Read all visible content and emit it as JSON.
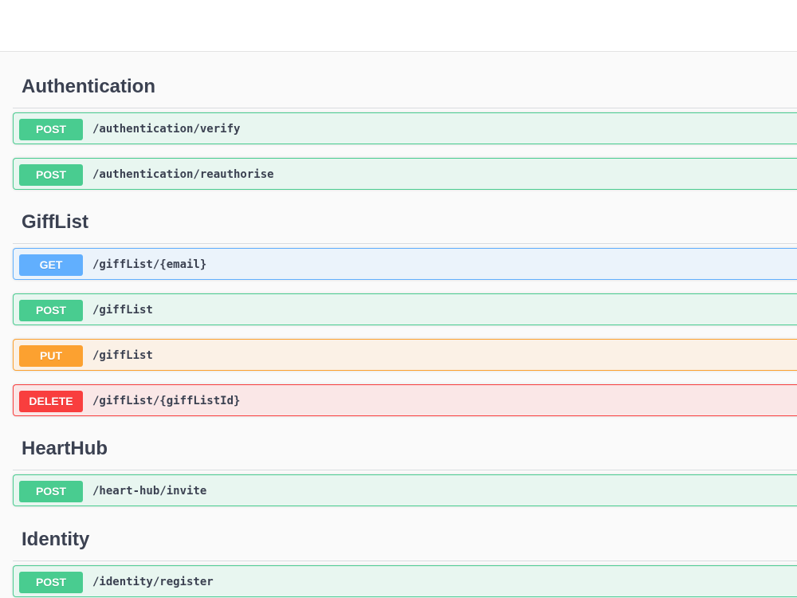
{
  "sections": [
    {
      "title": "Authentication",
      "operations": [
        {
          "method": "POST",
          "path": "/authentication/verify"
        },
        {
          "method": "POST",
          "path": "/authentication/reauthorise"
        }
      ]
    },
    {
      "title": "GiffList",
      "operations": [
        {
          "method": "GET",
          "path": "/giffList/{email}"
        },
        {
          "method": "POST",
          "path": "/giffList"
        },
        {
          "method": "PUT",
          "path": "/giffList"
        },
        {
          "method": "DELETE",
          "path": "/giffList/{giffListId}"
        }
      ]
    },
    {
      "title": "HeartHub",
      "operations": [
        {
          "method": "POST",
          "path": "/heart-hub/invite"
        }
      ]
    },
    {
      "title": "Identity",
      "operations": [
        {
          "method": "POST",
          "path": "/identity/register"
        }
      ]
    }
  ],
  "colors": {
    "post": "#49cc90",
    "get": "#61affe",
    "put": "#fca130",
    "delete": "#f93e3e",
    "text": "#3b4151"
  }
}
